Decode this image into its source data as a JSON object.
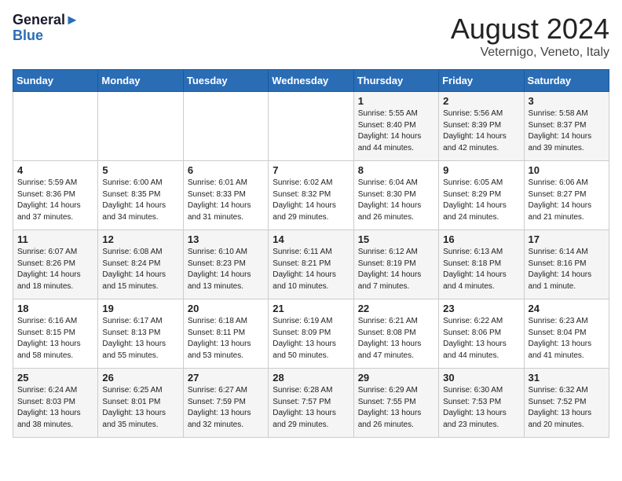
{
  "header": {
    "logo_line1": "General",
    "logo_line2": "Blue",
    "month_year": "August 2024",
    "location": "Veternigo, Veneto, Italy"
  },
  "days_of_week": [
    "Sunday",
    "Monday",
    "Tuesday",
    "Wednesday",
    "Thursday",
    "Friday",
    "Saturday"
  ],
  "weeks": [
    [
      {
        "day": "",
        "info": ""
      },
      {
        "day": "",
        "info": ""
      },
      {
        "day": "",
        "info": ""
      },
      {
        "day": "",
        "info": ""
      },
      {
        "day": "1",
        "info": "Sunrise: 5:55 AM\nSunset: 8:40 PM\nDaylight: 14 hours and 44 minutes."
      },
      {
        "day": "2",
        "info": "Sunrise: 5:56 AM\nSunset: 8:39 PM\nDaylight: 14 hours and 42 minutes."
      },
      {
        "day": "3",
        "info": "Sunrise: 5:58 AM\nSunset: 8:37 PM\nDaylight: 14 hours and 39 minutes."
      }
    ],
    [
      {
        "day": "4",
        "info": "Sunrise: 5:59 AM\nSunset: 8:36 PM\nDaylight: 14 hours and 37 minutes."
      },
      {
        "day": "5",
        "info": "Sunrise: 6:00 AM\nSunset: 8:35 PM\nDaylight: 14 hours and 34 minutes."
      },
      {
        "day": "6",
        "info": "Sunrise: 6:01 AM\nSunset: 8:33 PM\nDaylight: 14 hours and 31 minutes."
      },
      {
        "day": "7",
        "info": "Sunrise: 6:02 AM\nSunset: 8:32 PM\nDaylight: 14 hours and 29 minutes."
      },
      {
        "day": "8",
        "info": "Sunrise: 6:04 AM\nSunset: 8:30 PM\nDaylight: 14 hours and 26 minutes."
      },
      {
        "day": "9",
        "info": "Sunrise: 6:05 AM\nSunset: 8:29 PM\nDaylight: 14 hours and 24 minutes."
      },
      {
        "day": "10",
        "info": "Sunrise: 6:06 AM\nSunset: 8:27 PM\nDaylight: 14 hours and 21 minutes."
      }
    ],
    [
      {
        "day": "11",
        "info": "Sunrise: 6:07 AM\nSunset: 8:26 PM\nDaylight: 14 hours and 18 minutes."
      },
      {
        "day": "12",
        "info": "Sunrise: 6:08 AM\nSunset: 8:24 PM\nDaylight: 14 hours and 15 minutes."
      },
      {
        "day": "13",
        "info": "Sunrise: 6:10 AM\nSunset: 8:23 PM\nDaylight: 14 hours and 13 minutes."
      },
      {
        "day": "14",
        "info": "Sunrise: 6:11 AM\nSunset: 8:21 PM\nDaylight: 14 hours and 10 minutes."
      },
      {
        "day": "15",
        "info": "Sunrise: 6:12 AM\nSunset: 8:19 PM\nDaylight: 14 hours and 7 minutes."
      },
      {
        "day": "16",
        "info": "Sunrise: 6:13 AM\nSunset: 8:18 PM\nDaylight: 14 hours and 4 minutes."
      },
      {
        "day": "17",
        "info": "Sunrise: 6:14 AM\nSunset: 8:16 PM\nDaylight: 14 hours and 1 minute."
      }
    ],
    [
      {
        "day": "18",
        "info": "Sunrise: 6:16 AM\nSunset: 8:15 PM\nDaylight: 13 hours and 58 minutes."
      },
      {
        "day": "19",
        "info": "Sunrise: 6:17 AM\nSunset: 8:13 PM\nDaylight: 13 hours and 55 minutes."
      },
      {
        "day": "20",
        "info": "Sunrise: 6:18 AM\nSunset: 8:11 PM\nDaylight: 13 hours and 53 minutes."
      },
      {
        "day": "21",
        "info": "Sunrise: 6:19 AM\nSunset: 8:09 PM\nDaylight: 13 hours and 50 minutes."
      },
      {
        "day": "22",
        "info": "Sunrise: 6:21 AM\nSunset: 8:08 PM\nDaylight: 13 hours and 47 minutes."
      },
      {
        "day": "23",
        "info": "Sunrise: 6:22 AM\nSunset: 8:06 PM\nDaylight: 13 hours and 44 minutes."
      },
      {
        "day": "24",
        "info": "Sunrise: 6:23 AM\nSunset: 8:04 PM\nDaylight: 13 hours and 41 minutes."
      }
    ],
    [
      {
        "day": "25",
        "info": "Sunrise: 6:24 AM\nSunset: 8:03 PM\nDaylight: 13 hours and 38 minutes."
      },
      {
        "day": "26",
        "info": "Sunrise: 6:25 AM\nSunset: 8:01 PM\nDaylight: 13 hours and 35 minutes."
      },
      {
        "day": "27",
        "info": "Sunrise: 6:27 AM\nSunset: 7:59 PM\nDaylight: 13 hours and 32 minutes."
      },
      {
        "day": "28",
        "info": "Sunrise: 6:28 AM\nSunset: 7:57 PM\nDaylight: 13 hours and 29 minutes."
      },
      {
        "day": "29",
        "info": "Sunrise: 6:29 AM\nSunset: 7:55 PM\nDaylight: 13 hours and 26 minutes."
      },
      {
        "day": "30",
        "info": "Sunrise: 6:30 AM\nSunset: 7:53 PM\nDaylight: 13 hours and 23 minutes."
      },
      {
        "day": "31",
        "info": "Sunrise: 6:32 AM\nSunset: 7:52 PM\nDaylight: 13 hours and 20 minutes."
      }
    ]
  ]
}
